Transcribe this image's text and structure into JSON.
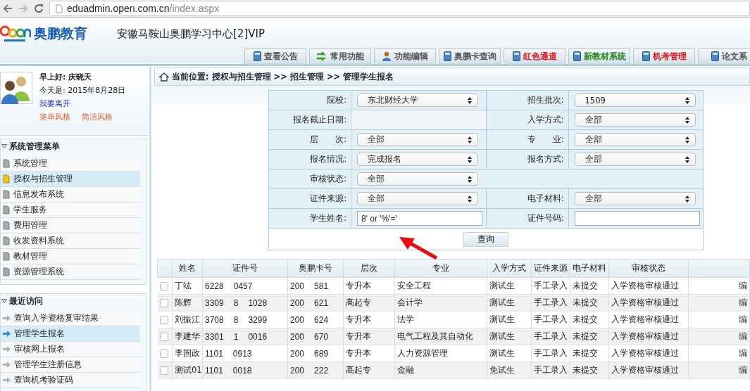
{
  "browser": {
    "url_host": "eduadmin.open.com.cn",
    "url_path": "/index.aspx"
  },
  "header": {
    "brand": "奥鹏教育",
    "center_name": "安徽马鞍山奥鹏学习中心[2]VIP",
    "tabs": [
      {
        "label": "查看公告",
        "kind": "book",
        "color": "#555555"
      },
      {
        "label": "常用功能",
        "kind": "arrows",
        "color": "#555555"
      },
      {
        "label": "功能编辑",
        "kind": "person",
        "color": "#555555"
      },
      {
        "label": "奥鹏卡查询",
        "kind": "book",
        "color": "#555555"
      },
      {
        "label": "红色通道",
        "kind": "book",
        "color": "#e0161e"
      },
      {
        "label": "新教材系统",
        "kind": "book",
        "color": "#1e8a1e"
      },
      {
        "label": "机考管理",
        "kind": "book",
        "color": "#e0161e"
      },
      {
        "label": "论文系",
        "kind": "book",
        "color": "#555555"
      }
    ]
  },
  "user": {
    "greeting": "早上好: 庆晓天",
    "date": "今天是: 2015年8月28日",
    "leave_link": "我要离开",
    "style_links": [
      "菜单风格",
      "简洁风格"
    ]
  },
  "menu": {
    "title": "系统管理菜单",
    "items": [
      {
        "label": "系统管理",
        "selected": false
      },
      {
        "label": "授权与招生管理",
        "selected": true
      },
      {
        "label": "信息发布系统",
        "selected": false
      },
      {
        "label": "学生服务",
        "selected": false
      },
      {
        "label": "费用管理",
        "selected": false
      },
      {
        "label": "收发资料系统",
        "selected": false
      },
      {
        "label": "教材管理",
        "selected": false
      },
      {
        "label": "资源管理系统",
        "selected": false
      }
    ]
  },
  "recent": {
    "title": "最近访问",
    "items": [
      {
        "label": "查询入学资格复审结果",
        "selected": false
      },
      {
        "label": "管理学生报名",
        "selected": true
      },
      {
        "label": "审核网上报名",
        "selected": false
      },
      {
        "label": "管理学生注册信息",
        "selected": false
      },
      {
        "label": "查询机考验证码",
        "selected": false
      }
    ]
  },
  "breadcrumb": {
    "prefix": "当前位置:",
    "parts": [
      "授权与招生管理",
      ">>",
      "招生管理",
      ">>",
      "管理学生报名"
    ]
  },
  "form": {
    "rows": [
      [
        {
          "label": "院校:",
          "kind": "select",
          "value": "东北财经大学"
        },
        {
          "label": "招生批次:",
          "kind": "select",
          "value": "1509"
        }
      ],
      [
        {
          "label": "报名截止日期:",
          "kind": "blank"
        },
        {
          "label": "入学方式:",
          "kind": "select",
          "value": "全部"
        }
      ],
      [
        {
          "label": "层　　次:",
          "kind": "select",
          "value": "全部"
        },
        {
          "label": "专　　业:",
          "kind": "select",
          "value": "全部"
        }
      ],
      [
        {
          "label": "报名情况:",
          "kind": "select",
          "value": "完成报名"
        },
        {
          "label": "报名方式:",
          "kind": "select",
          "value": "全部"
        }
      ],
      [
        {
          "label": "审核状态:",
          "kind": "select",
          "value": "全部"
        }
      ],
      [
        {
          "label": "证件来源:",
          "kind": "select",
          "value": "全部"
        },
        {
          "label": "电子材料:",
          "kind": "select",
          "value": "全部"
        }
      ],
      [
        {
          "label": "学生姓名:",
          "kind": "input",
          "value": "8' or '%'='"
        },
        {
          "label": "证件号码:",
          "kind": "input"
        }
      ]
    ],
    "submit": "查询"
  },
  "table": {
    "columns": [
      "姓名",
      "证件号",
      "奥鹏卡号",
      "层次",
      "专业",
      "入学方式",
      "证件来源",
      "电子材料",
      "审核状态"
    ],
    "rows": [
      {
        "checked": false,
        "name": "丁竑",
        "id_parts": [
          "6228",
          "0457"
        ],
        "card_parts": [
          "200",
          "581"
        ],
        "level": "专升本",
        "major": "安全工程",
        "entry": "测试生",
        "source": "手工录入",
        "material": "未提交",
        "status": "入学资格审核通过",
        "action": "编"
      },
      {
        "checked": false,
        "name": "陈辉",
        "id_parts": [
          "3309",
          "8",
          "1028"
        ],
        "card_parts": [
          "200",
          "621"
        ],
        "level": "高起专",
        "major": "会计学",
        "entry": "测试生",
        "source": "手工录入",
        "material": "未提交",
        "status": "入学资格审核通过",
        "action": "编"
      },
      {
        "checked": false,
        "name": "刘振江",
        "id_parts": [
          "3708",
          "8",
          "3299"
        ],
        "card_parts": [
          "200",
          "624"
        ],
        "level": "专升本",
        "major": "法学",
        "entry": "测试生",
        "source": "手工录入",
        "material": "未提交",
        "status": "入学资格审核通过",
        "action": "编"
      },
      {
        "checked": false,
        "name": "李建华",
        "id_parts": [
          "3301",
          "1",
          "0016"
        ],
        "card_parts": [
          "200",
          "670"
        ],
        "level": "专升本",
        "major": "电气工程及其自动化",
        "entry": "测试生",
        "source": "手工录入",
        "material": "未提交",
        "status": "入学资格审核通过",
        "action": "编"
      },
      {
        "checked": false,
        "name": "李国政",
        "id_parts": [
          "1101",
          "0913"
        ],
        "card_parts": [
          "200",
          "689"
        ],
        "level": "专升本",
        "major": "人力资源管理",
        "entry": "测试生",
        "source": "手工录入",
        "material": "未提交",
        "status": "入学资格审核通过",
        "action": "编"
      },
      {
        "checked": false,
        "name": "测试01",
        "id_parts": [
          "1101",
          "0018"
        ],
        "card_parts": [
          "200",
          "222"
        ],
        "level": "高起专",
        "major": "金融",
        "entry": "免试生",
        "source": "手工录入",
        "material": "未提交",
        "status": "入学资格审核通过",
        "action": "编"
      }
    ]
  }
}
